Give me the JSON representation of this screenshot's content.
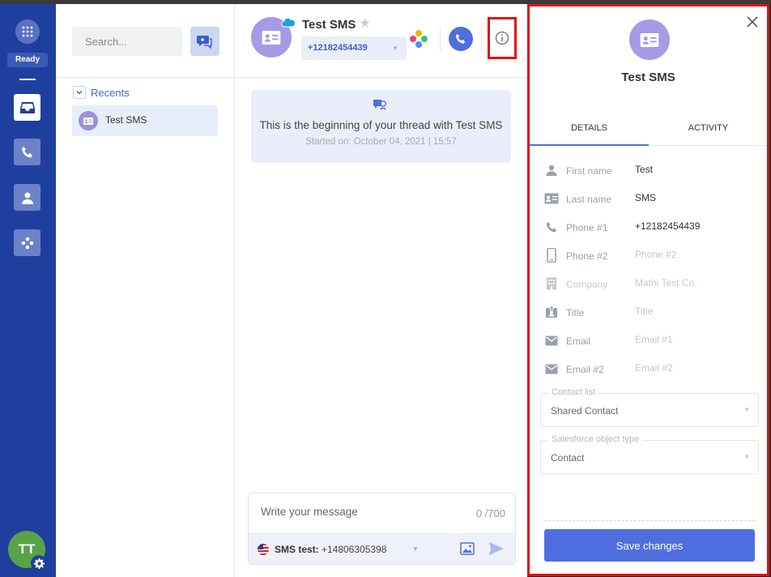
{
  "rail": {
    "status": "Ready",
    "avatar_initials": "TT",
    "icons": [
      "dialpad-icon",
      "inbox-icon",
      "phone-icon",
      "contacts-icon",
      "apps-icon",
      "gear-icon"
    ]
  },
  "conversations": {
    "search_placeholder": "Search...",
    "recents_label": "Recents",
    "items": [
      {
        "name": "Test SMS"
      }
    ]
  },
  "thread": {
    "contact_name": "Test SMS",
    "phone": "+12182454439",
    "start_message": "This is the beginning of your thread with Test SMS",
    "start_date": "Started on: October 04, 2021 | 15:57",
    "composer": {
      "placeholder": "Write your message",
      "char_count": "0 /700",
      "sender_label": "SMS test:",
      "sender_number": "+14806305398"
    }
  },
  "panel": {
    "contact_name": "Test SMS",
    "tabs": [
      "DETAILS",
      "ACTIVITY"
    ],
    "fields": [
      {
        "label": "First name",
        "value": "Test",
        "placeholder": false,
        "disabled": false,
        "icon": "person-icon"
      },
      {
        "label": "Last name",
        "value": "SMS",
        "placeholder": false,
        "disabled": false,
        "icon": "id-card-icon"
      },
      {
        "label": "Phone #1",
        "value": "+12182454439",
        "placeholder": false,
        "disabled": false,
        "icon": "phone-icon"
      },
      {
        "label": "Phone #2",
        "value": "Phone #2",
        "placeholder": true,
        "disabled": false,
        "icon": "mobile-icon"
      },
      {
        "label": "Company",
        "value": "Mathi Test Co.",
        "placeholder": false,
        "disabled": true,
        "icon": "building-icon"
      },
      {
        "label": "Title",
        "value": "Title",
        "placeholder": true,
        "disabled": false,
        "icon": "badge-icon"
      },
      {
        "label": "Email",
        "value": "Email #1",
        "placeholder": true,
        "disabled": false,
        "icon": "email-icon"
      },
      {
        "label": "Email #2",
        "value": "Email #2",
        "placeholder": true,
        "disabled": false,
        "icon": "email-icon"
      }
    ],
    "contact_list": {
      "label": "Contact list",
      "value": "Shared Contact"
    },
    "object_type": {
      "label": "Salesforce object type",
      "value": "Contact"
    },
    "save_label": "Save changes"
  },
  "colors": {
    "rail": "#1f3f9e",
    "accent": "#4f6fe0",
    "avatar": "#a79ae6",
    "highlight": "#e01010"
  }
}
